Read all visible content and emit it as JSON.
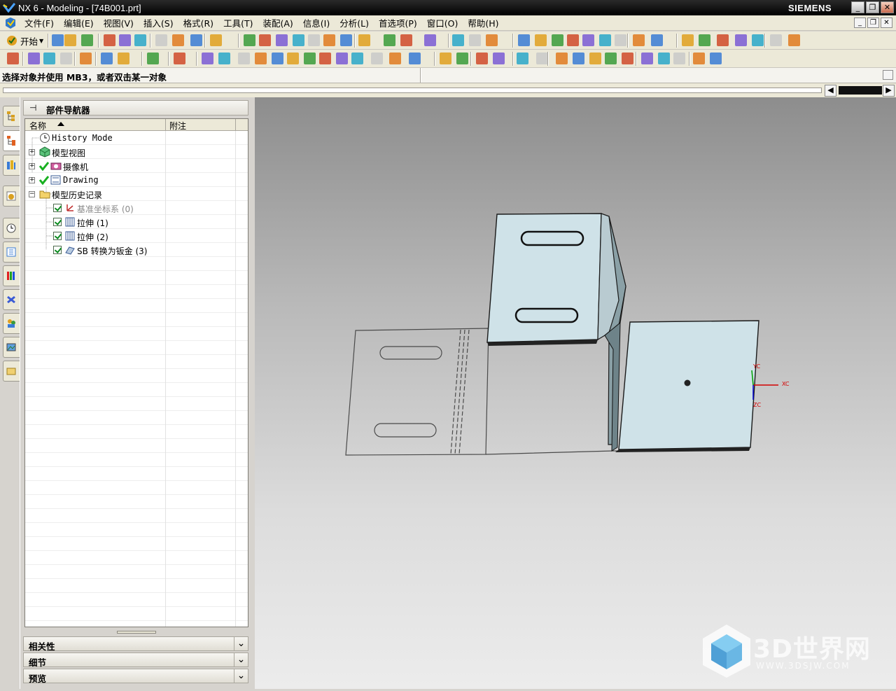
{
  "window": {
    "title": "NX 6 - Modeling - [74B001.prt]",
    "brand": "SIEMENS",
    "minimize": "_",
    "restore": "❐",
    "close": "✕"
  },
  "menu": {
    "items": [
      "文件(F)",
      "编辑(E)",
      "视图(V)",
      "插入(S)",
      "格式(R)",
      "工具(T)",
      "装配(A)",
      "信息(I)",
      "分析(L)",
      "首选项(P)",
      "窗口(O)",
      "帮助(H)"
    ]
  },
  "toolbar": {
    "start_label": "开始"
  },
  "cue": {
    "text": "选择对象并使用 MB3，或者双击某一对象"
  },
  "navigator": {
    "title": "部件导航器",
    "columns": [
      "名称",
      "附注"
    ],
    "nodes": [
      {
        "label": "History Mode",
        "mono": true
      },
      {
        "label": "模型视图",
        "mono": false
      },
      {
        "label": "摄像机",
        "mono": false
      },
      {
        "label": "Drawing",
        "mono": true
      },
      {
        "label": "模型历史记录",
        "mono": false
      },
      {
        "label": "基准坐标系 (0)",
        "mono": false
      },
      {
        "label": "拉伸 (1)",
        "mono": false
      },
      {
        "label": "拉伸 (2)",
        "mono": false
      },
      {
        "label": "SB 转换为钣金 (3)",
        "mono": false
      }
    ],
    "panels": [
      "相关性",
      "细节",
      "预览"
    ]
  },
  "viewport": {
    "axes": {
      "x": "XC",
      "y": "YC",
      "z": "ZC"
    },
    "colors": {
      "part_fill": "#cfe2e8",
      "part_edge": "#1a1a1a",
      "x_axis": "#d40000",
      "y_axis": "#00a000"
    }
  },
  "watermark": {
    "text": "3D世界网",
    "url": "WWW.3DSJW.COM"
  }
}
